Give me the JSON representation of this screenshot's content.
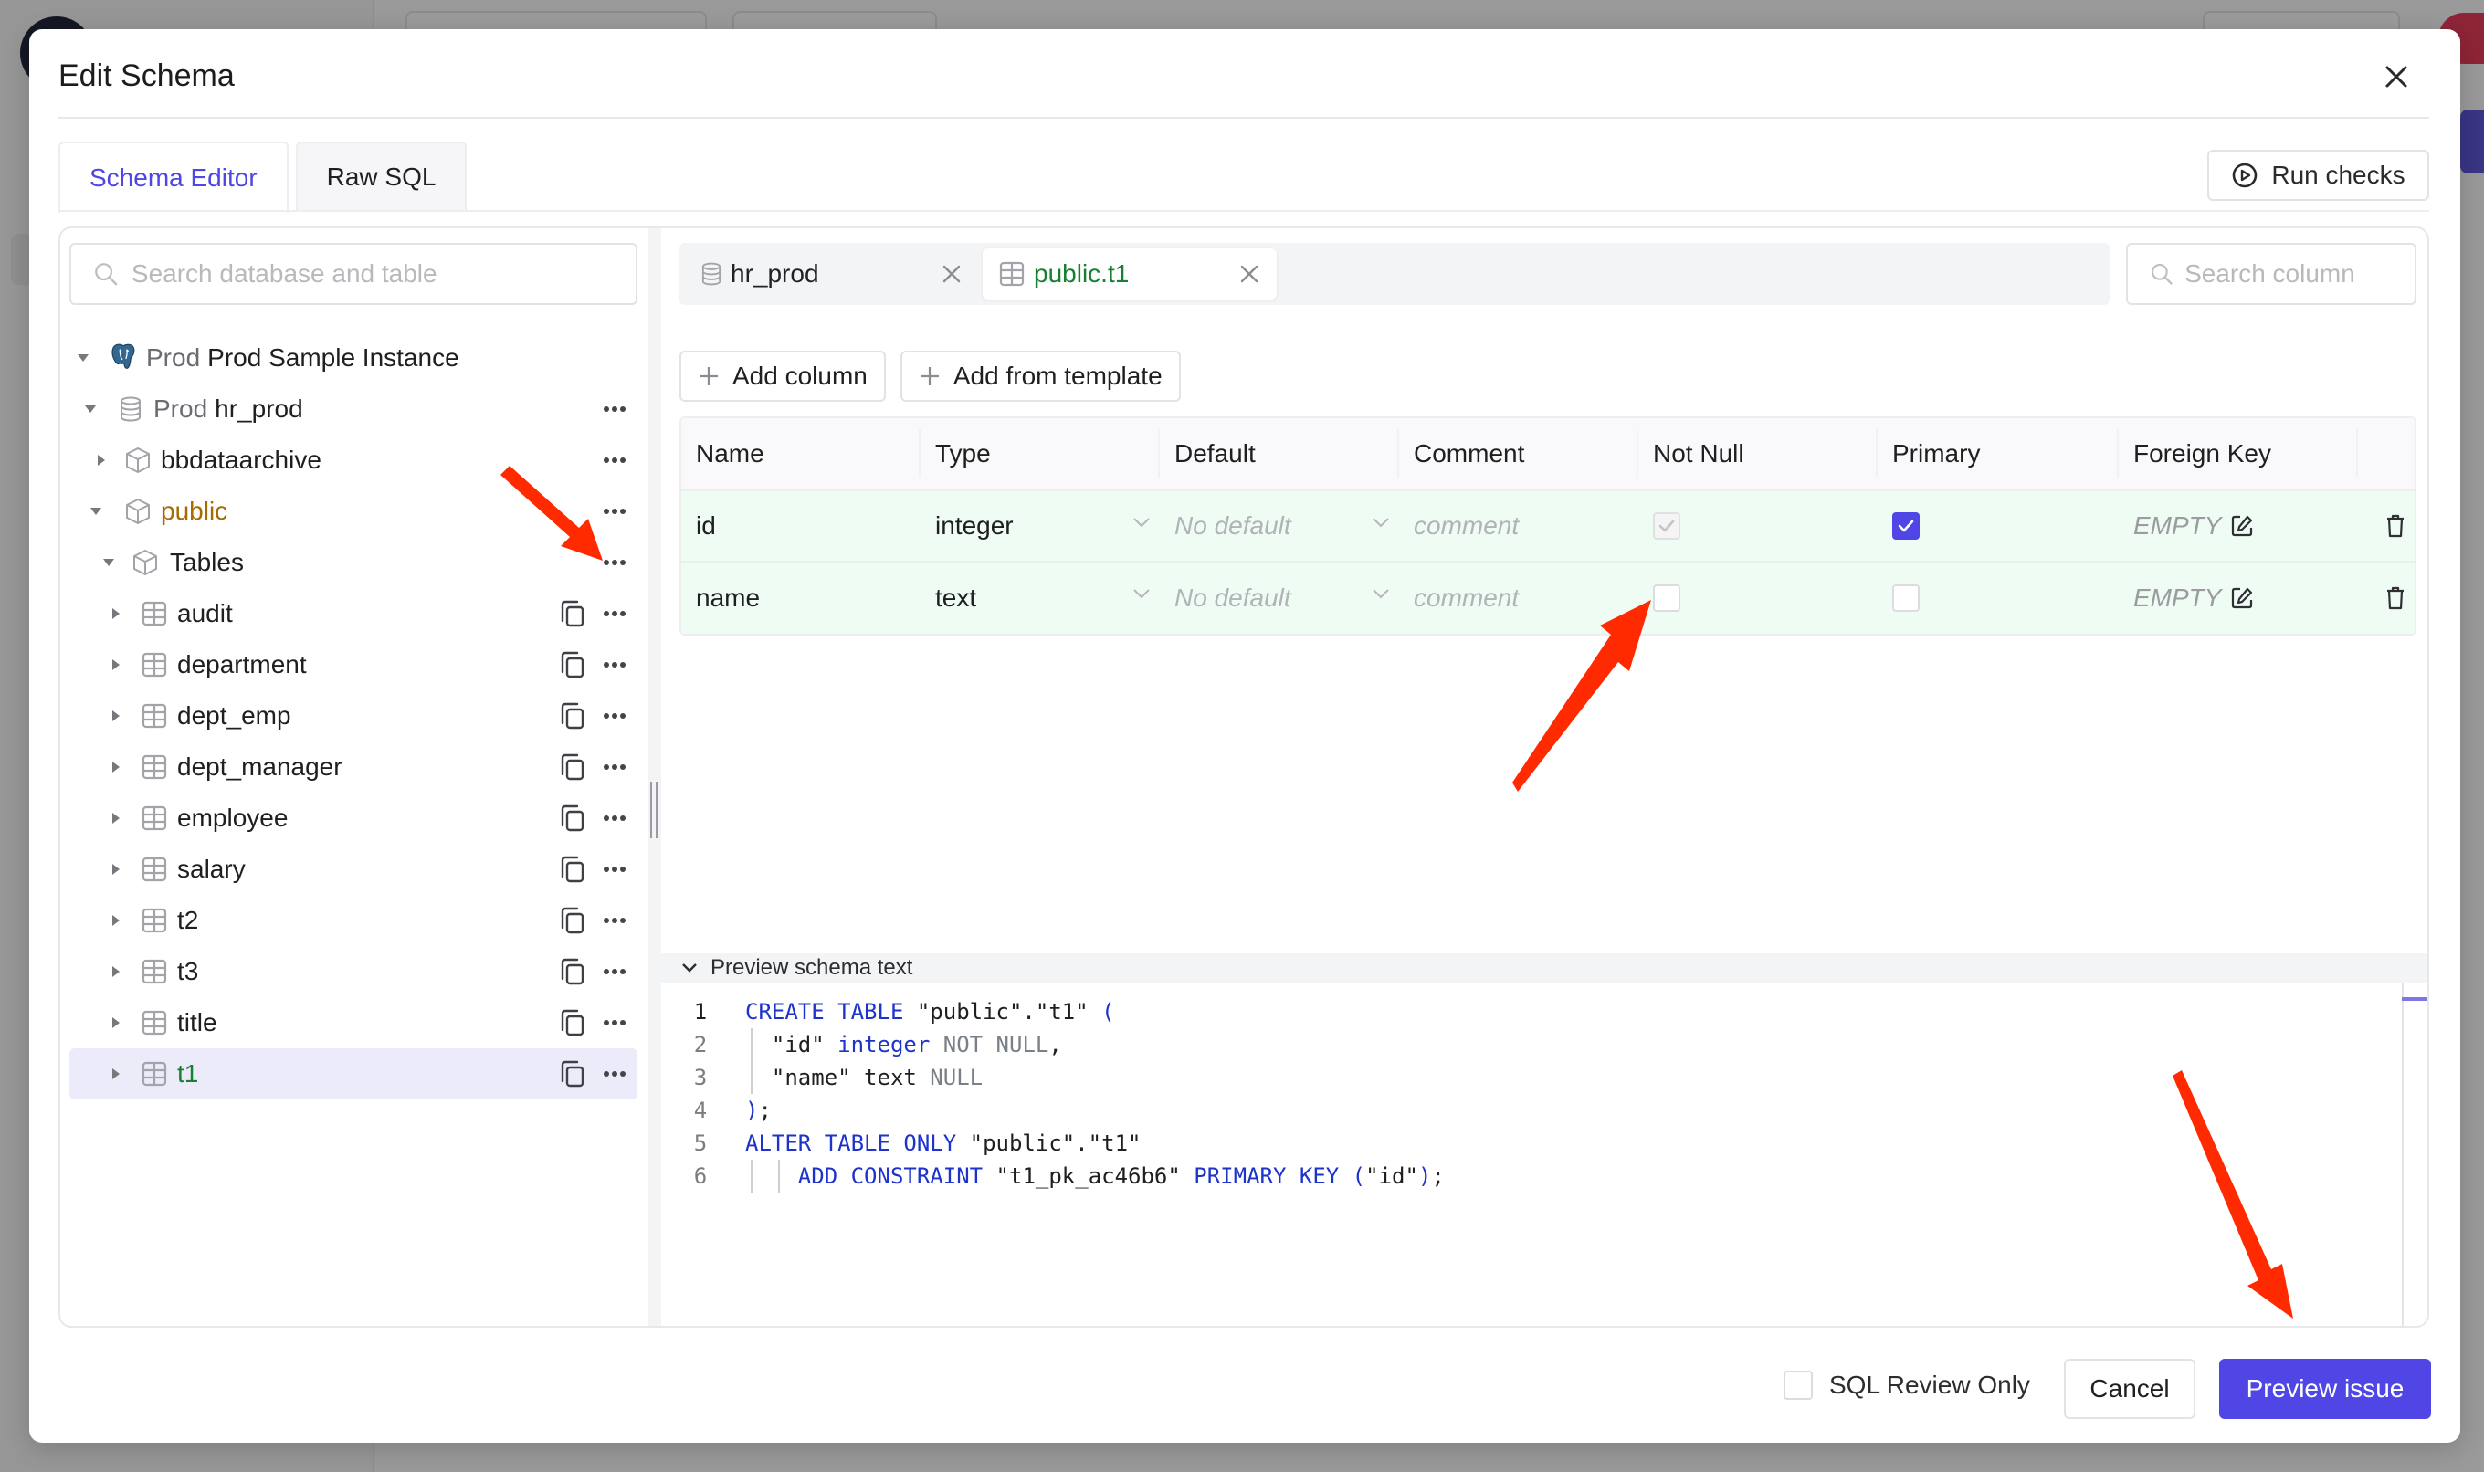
{
  "dialog": {
    "title": "Edit Schema",
    "close_icon": "close-icon"
  },
  "tabs": [
    {
      "label": "Schema Editor",
      "active": true
    },
    {
      "label": "Raw SQL",
      "active": false
    }
  ],
  "run_checks": {
    "label": "Run checks",
    "icon": "play-circle-icon"
  },
  "left_panel": {
    "search_placeholder": "Search database and table",
    "instance": {
      "prefix": "Prod",
      "name": "Prod Sample Instance",
      "icon": "postgres-elephant-icon"
    },
    "database": {
      "prefix": "Prod",
      "name": "hr_prod",
      "icon": "database-icon"
    },
    "schemas": [
      {
        "name": "bbdataarchive",
        "expanded": false
      },
      {
        "name": "public",
        "expanded": true
      }
    ],
    "tables_group": {
      "label": "Tables",
      "expanded": true
    },
    "tables": [
      {
        "name": "audit",
        "selected": false
      },
      {
        "name": "department",
        "selected": false
      },
      {
        "name": "dept_emp",
        "selected": false
      },
      {
        "name": "dept_manager",
        "selected": false
      },
      {
        "name": "employee",
        "selected": false
      },
      {
        "name": "salary",
        "selected": false
      },
      {
        "name": "t2",
        "selected": false
      },
      {
        "name": "t3",
        "selected": false
      },
      {
        "name": "title",
        "selected": false
      },
      {
        "name": "t1",
        "selected": true
      }
    ]
  },
  "editor_tabs": [
    {
      "label": "hr_prod",
      "icon": "database-icon",
      "active": false
    },
    {
      "label": "public.t1",
      "icon": "table-icon",
      "active": true
    }
  ],
  "search_column_placeholder": "Search column",
  "actions": {
    "add_column": "Add column",
    "add_from_template": "Add from template"
  },
  "columns_table": {
    "headers": [
      "Name",
      "Type",
      "Default",
      "Comment",
      "Not Null",
      "Primary",
      "Foreign Key",
      ""
    ],
    "rows": [
      {
        "name": "id",
        "type": "integer",
        "default_placeholder": "No default",
        "comment_placeholder": "comment",
        "not_null": true,
        "not_null_disabled": true,
        "primary": true,
        "foreign_key": "EMPTY"
      },
      {
        "name": "name",
        "type": "text",
        "default_placeholder": "No default",
        "comment_placeholder": "comment",
        "not_null": false,
        "not_null_disabled": false,
        "primary": false,
        "foreign_key": "EMPTY"
      }
    ]
  },
  "preview": {
    "label": "Preview schema text",
    "lines": [
      {
        "n": "1",
        "tokens": [
          {
            "t": "CREATE TABLE",
            "c": "kw"
          },
          {
            "t": " \"public\".\"t1\" ",
            "c": ""
          },
          {
            "t": "(",
            "c": "kw"
          }
        ]
      },
      {
        "n": "2",
        "tokens": [
          {
            "t": "  \"id\" ",
            "c": ""
          },
          {
            "t": "integer",
            "c": "kw"
          },
          {
            "t": " NOT NULL",
            "c": "nl"
          },
          {
            "t": ",",
            "c": ""
          }
        ]
      },
      {
        "n": "3",
        "tokens": [
          {
            "t": "  \"name\" text ",
            "c": ""
          },
          {
            "t": "NULL",
            "c": "nl"
          }
        ]
      },
      {
        "n": "4",
        "tokens": [
          {
            "t": ")",
            "c": "kw"
          },
          {
            "t": ";",
            "c": ""
          }
        ]
      },
      {
        "n": "5",
        "tokens": [
          {
            "t": "ALTER TABLE ONLY",
            "c": "kw"
          },
          {
            "t": " \"public\".\"t1\"",
            "c": ""
          }
        ]
      },
      {
        "n": "6",
        "tokens": [
          {
            "t": "    ",
            "c": ""
          },
          {
            "t": "ADD CONSTRAINT",
            "c": "kw"
          },
          {
            "t": " \"t1_pk_ac46b6\" ",
            "c": ""
          },
          {
            "t": "PRIMARY KEY",
            "c": "kw"
          },
          {
            "t": " (",
            "c": "kw"
          },
          {
            "t": "\"id\"",
            "c": ""
          },
          {
            "t": ")",
            "c": "kw"
          },
          {
            "t": ";",
            "c": ""
          }
        ]
      }
    ]
  },
  "footer": {
    "sql_review_only": {
      "label": "SQL Review Only",
      "checked": false
    },
    "cancel": "Cancel",
    "preview_issue": "Preview issue"
  },
  "colors": {
    "accent": "#4f46e5",
    "schema_name": "#a86b00",
    "active_table": "#178033",
    "new_row_bg": "#effcf3",
    "annotation_arrow": "#ff2a00"
  }
}
